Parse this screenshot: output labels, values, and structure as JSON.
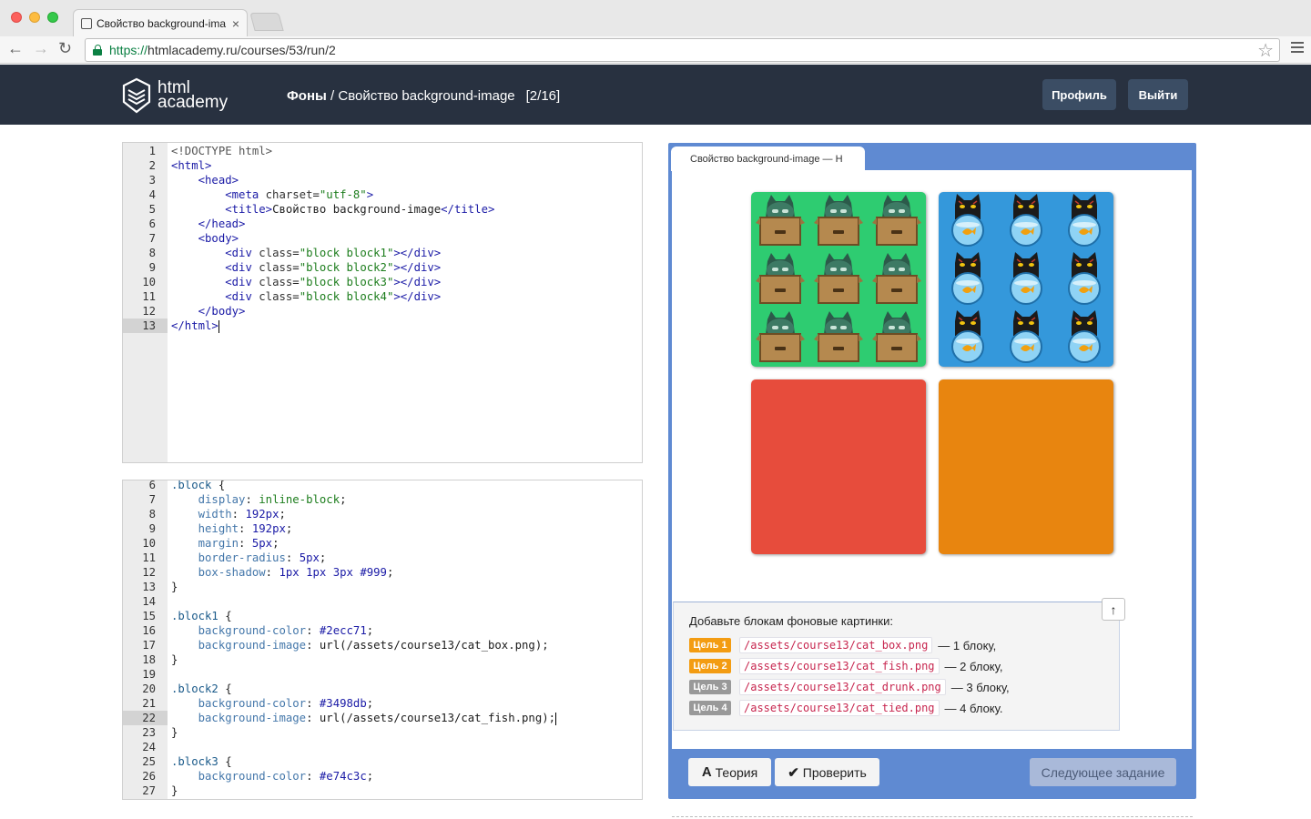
{
  "browser": {
    "tab_title": "Свойство background-ima",
    "tab_close": "×",
    "url_scheme": "https://",
    "url_rest": "htmlacademy.ru/courses/53/run/2",
    "icons": [
      "back-arrow-icon",
      "forward-arrow-icon",
      "reload-icon",
      "lock-icon",
      "star-icon",
      "menu-icon"
    ]
  },
  "header": {
    "logo_line1": "html",
    "logo_line2": "academy",
    "section": "Фоны",
    "separator": " / ",
    "lesson": "Свойство background-image",
    "progress": "[2/16]",
    "profile_label": "Профиль",
    "logout_label": "Выйти",
    "bg_color": "#283140"
  },
  "html_editor": {
    "active_line": 13,
    "lines": [
      {
        "n": "1",
        "tokens": [
          {
            "c": "t-dt",
            "t": "<!DOCTYPE html>"
          }
        ]
      },
      {
        "n": "2",
        "tokens": [
          {
            "c": "t-tag",
            "t": "<html>"
          }
        ]
      },
      {
        "n": "3",
        "tokens": [
          {
            "c": "",
            "t": "    "
          },
          {
            "c": "t-tag",
            "t": "<head>"
          }
        ]
      },
      {
        "n": "4",
        "tokens": [
          {
            "c": "",
            "t": "        "
          },
          {
            "c": "t-tag",
            "t": "<meta "
          },
          {
            "c": "t-attr",
            "t": "charset"
          },
          {
            "c": "t-pun",
            "t": "="
          },
          {
            "c": "t-str",
            "t": "\"utf-8\""
          },
          {
            "c": "t-tag",
            "t": ">"
          }
        ]
      },
      {
        "n": "5",
        "tokens": [
          {
            "c": "",
            "t": "        "
          },
          {
            "c": "t-tag",
            "t": "<title>"
          },
          {
            "c": "t-pun",
            "t": "Свойство background-image"
          },
          {
            "c": "t-tag",
            "t": "</title>"
          }
        ]
      },
      {
        "n": "6",
        "tokens": [
          {
            "c": "",
            "t": "    "
          },
          {
            "c": "t-tag",
            "t": "</head>"
          }
        ]
      },
      {
        "n": "7",
        "tokens": [
          {
            "c": "",
            "t": "    "
          },
          {
            "c": "t-tag",
            "t": "<body>"
          }
        ]
      },
      {
        "n": "8",
        "tokens": [
          {
            "c": "",
            "t": "        "
          },
          {
            "c": "t-tag",
            "t": "<div "
          },
          {
            "c": "t-attr",
            "t": "class"
          },
          {
            "c": "t-pun",
            "t": "="
          },
          {
            "c": "t-str",
            "t": "\"block block1\""
          },
          {
            "c": "t-tag",
            "t": "></div>"
          }
        ]
      },
      {
        "n": "9",
        "tokens": [
          {
            "c": "",
            "t": "        "
          },
          {
            "c": "t-tag",
            "t": "<div "
          },
          {
            "c": "t-attr",
            "t": "class"
          },
          {
            "c": "t-pun",
            "t": "="
          },
          {
            "c": "t-str",
            "t": "\"block block2\""
          },
          {
            "c": "t-tag",
            "t": "></div>"
          }
        ]
      },
      {
        "n": "10",
        "tokens": [
          {
            "c": "",
            "t": "        "
          },
          {
            "c": "t-tag",
            "t": "<div "
          },
          {
            "c": "t-attr",
            "t": "class"
          },
          {
            "c": "t-pun",
            "t": "="
          },
          {
            "c": "t-str",
            "t": "\"block block3\""
          },
          {
            "c": "t-tag",
            "t": "></div>"
          }
        ]
      },
      {
        "n": "11",
        "tokens": [
          {
            "c": "",
            "t": "        "
          },
          {
            "c": "t-tag",
            "t": "<div "
          },
          {
            "c": "t-attr",
            "t": "class"
          },
          {
            "c": "t-pun",
            "t": "="
          },
          {
            "c": "t-str",
            "t": "\"block block4\""
          },
          {
            "c": "t-tag",
            "t": "></div>"
          }
        ]
      },
      {
        "n": "12",
        "tokens": [
          {
            "c": "",
            "t": "    "
          },
          {
            "c": "t-tag",
            "t": "</body>"
          }
        ]
      },
      {
        "n": "13",
        "tokens": [
          {
            "c": "t-tag",
            "t": "</html>"
          }
        ],
        "cursor": true
      }
    ]
  },
  "css_editor": {
    "active_line": 22,
    "lines": [
      {
        "n": "6",
        "tokens": [
          {
            "c": "t-sel",
            "t": ".block"
          },
          {
            "c": "t-pun",
            "t": " {"
          }
        ]
      },
      {
        "n": "7",
        "tokens": [
          {
            "c": "",
            "t": "    "
          },
          {
            "c": "t-prop",
            "t": "display"
          },
          {
            "c": "t-pun",
            "t": ": "
          },
          {
            "c": "t-kw",
            "t": "inline-block"
          },
          {
            "c": "t-pun",
            "t": ";"
          }
        ]
      },
      {
        "n": "8",
        "tokens": [
          {
            "c": "",
            "t": "    "
          },
          {
            "c": "t-prop",
            "t": "width"
          },
          {
            "c": "t-pun",
            "t": ": "
          },
          {
            "c": "t-val",
            "t": "192px"
          },
          {
            "c": "t-pun",
            "t": ";"
          }
        ]
      },
      {
        "n": "9",
        "tokens": [
          {
            "c": "",
            "t": "    "
          },
          {
            "c": "t-prop",
            "t": "height"
          },
          {
            "c": "t-pun",
            "t": ": "
          },
          {
            "c": "t-val",
            "t": "192px"
          },
          {
            "c": "t-pun",
            "t": ";"
          }
        ]
      },
      {
        "n": "10",
        "tokens": [
          {
            "c": "",
            "t": "    "
          },
          {
            "c": "t-prop",
            "t": "margin"
          },
          {
            "c": "t-pun",
            "t": ": "
          },
          {
            "c": "t-val",
            "t": "5px"
          },
          {
            "c": "t-pun",
            "t": ";"
          }
        ]
      },
      {
        "n": "11",
        "tokens": [
          {
            "c": "",
            "t": "    "
          },
          {
            "c": "t-prop",
            "t": "border-radius"
          },
          {
            "c": "t-pun",
            "t": ": "
          },
          {
            "c": "t-val",
            "t": "5px"
          },
          {
            "c": "t-pun",
            "t": ";"
          }
        ]
      },
      {
        "n": "12",
        "tokens": [
          {
            "c": "",
            "t": "    "
          },
          {
            "c": "t-prop",
            "t": "box-shadow"
          },
          {
            "c": "t-pun",
            "t": ": "
          },
          {
            "c": "t-val",
            "t": "1px 1px 3px #999"
          },
          {
            "c": "t-pun",
            "t": ";"
          }
        ]
      },
      {
        "n": "13",
        "tokens": [
          {
            "c": "t-pun",
            "t": "}"
          }
        ]
      },
      {
        "n": "14",
        "tokens": []
      },
      {
        "n": "15",
        "tokens": [
          {
            "c": "t-sel",
            "t": ".block1"
          },
          {
            "c": "t-pun",
            "t": " {"
          }
        ]
      },
      {
        "n": "16",
        "tokens": [
          {
            "c": "",
            "t": "    "
          },
          {
            "c": "t-prop",
            "t": "background-color"
          },
          {
            "c": "t-pun",
            "t": ": "
          },
          {
            "c": "t-val",
            "t": "#2ecc71"
          },
          {
            "c": "t-pun",
            "t": ";"
          }
        ]
      },
      {
        "n": "17",
        "tokens": [
          {
            "c": "",
            "t": "    "
          },
          {
            "c": "t-prop",
            "t": "background-image"
          },
          {
            "c": "t-pun",
            "t": ": "
          },
          {
            "c": "t-url",
            "t": "url(/assets/course13/cat_box.png)"
          },
          {
            "c": "t-pun",
            "t": ";"
          }
        ]
      },
      {
        "n": "18",
        "tokens": [
          {
            "c": "t-pun",
            "t": "}"
          }
        ]
      },
      {
        "n": "19",
        "tokens": []
      },
      {
        "n": "20",
        "tokens": [
          {
            "c": "t-sel",
            "t": ".block2"
          },
          {
            "c": "t-pun",
            "t": " {"
          }
        ]
      },
      {
        "n": "21",
        "tokens": [
          {
            "c": "",
            "t": "    "
          },
          {
            "c": "t-prop",
            "t": "background-color"
          },
          {
            "c": "t-pun",
            "t": ": "
          },
          {
            "c": "t-val",
            "t": "#3498db"
          },
          {
            "c": "t-pun",
            "t": ";"
          }
        ]
      },
      {
        "n": "22",
        "tokens": [
          {
            "c": "",
            "t": "    "
          },
          {
            "c": "t-prop",
            "t": "background-image"
          },
          {
            "c": "t-pun",
            "t": ": "
          },
          {
            "c": "t-url",
            "t": "url(/assets/course13/cat_fish.png)"
          },
          {
            "c": "t-pun",
            "t": ";"
          }
        ],
        "cursor": true
      },
      {
        "n": "23",
        "tokens": [
          {
            "c": "t-pun",
            "t": "}"
          }
        ]
      },
      {
        "n": "24",
        "tokens": []
      },
      {
        "n": "25",
        "tokens": [
          {
            "c": "t-sel",
            "t": ".block3"
          },
          {
            "c": "t-pun",
            "t": " {"
          }
        ]
      },
      {
        "n": "26",
        "tokens": [
          {
            "c": "",
            "t": "    "
          },
          {
            "c": "t-prop",
            "t": "background-color"
          },
          {
            "c": "t-pun",
            "t": ": "
          },
          {
            "c": "t-val",
            "t": "#e74c3c"
          },
          {
            "c": "t-pun",
            "t": ";"
          }
        ]
      },
      {
        "n": "27",
        "tokens": [
          {
            "c": "t-pun",
            "t": "}"
          }
        ]
      }
    ]
  },
  "preview": {
    "tab_title": "Свойство background-image — H",
    "frame_bg": "#5f8ad2",
    "blocks": [
      {
        "name": "block1",
        "color": "#2ecc71",
        "pattern": "cat_box"
      },
      {
        "name": "block2",
        "color": "#3498db",
        "pattern": "cat_fish"
      },
      {
        "name": "block3",
        "color": "#e74c3c",
        "pattern": "none"
      },
      {
        "name": "block4",
        "color": "#e8850f",
        "pattern": "none"
      }
    ]
  },
  "task": {
    "text": "Добавьте блокам фоновые картинки:",
    "goals": [
      {
        "badge": "Цель 1",
        "state": "pending",
        "code": "/assets/course13/cat_box.png",
        "suffix": "— 1 блоку,"
      },
      {
        "badge": "Цель 2",
        "state": "pending",
        "code": "/assets/course13/cat_fish.png",
        "suffix": "— 2 блоку,"
      },
      {
        "badge": "Цель 3",
        "state": "inactive",
        "code": "/assets/course13/cat_drunk.png",
        "suffix": "— 3 блоку,"
      },
      {
        "badge": "Цель 4",
        "state": "inactive",
        "code": "/assets/course13/cat_tied.png",
        "suffix": "— 4 блоку."
      }
    ],
    "scroll_up_icon": "↑"
  },
  "actions": {
    "theory_icon": "A",
    "theory_label": "Теория",
    "check_icon": "✔",
    "check_label": "Проверить",
    "next_label": "Следующее задание"
  }
}
